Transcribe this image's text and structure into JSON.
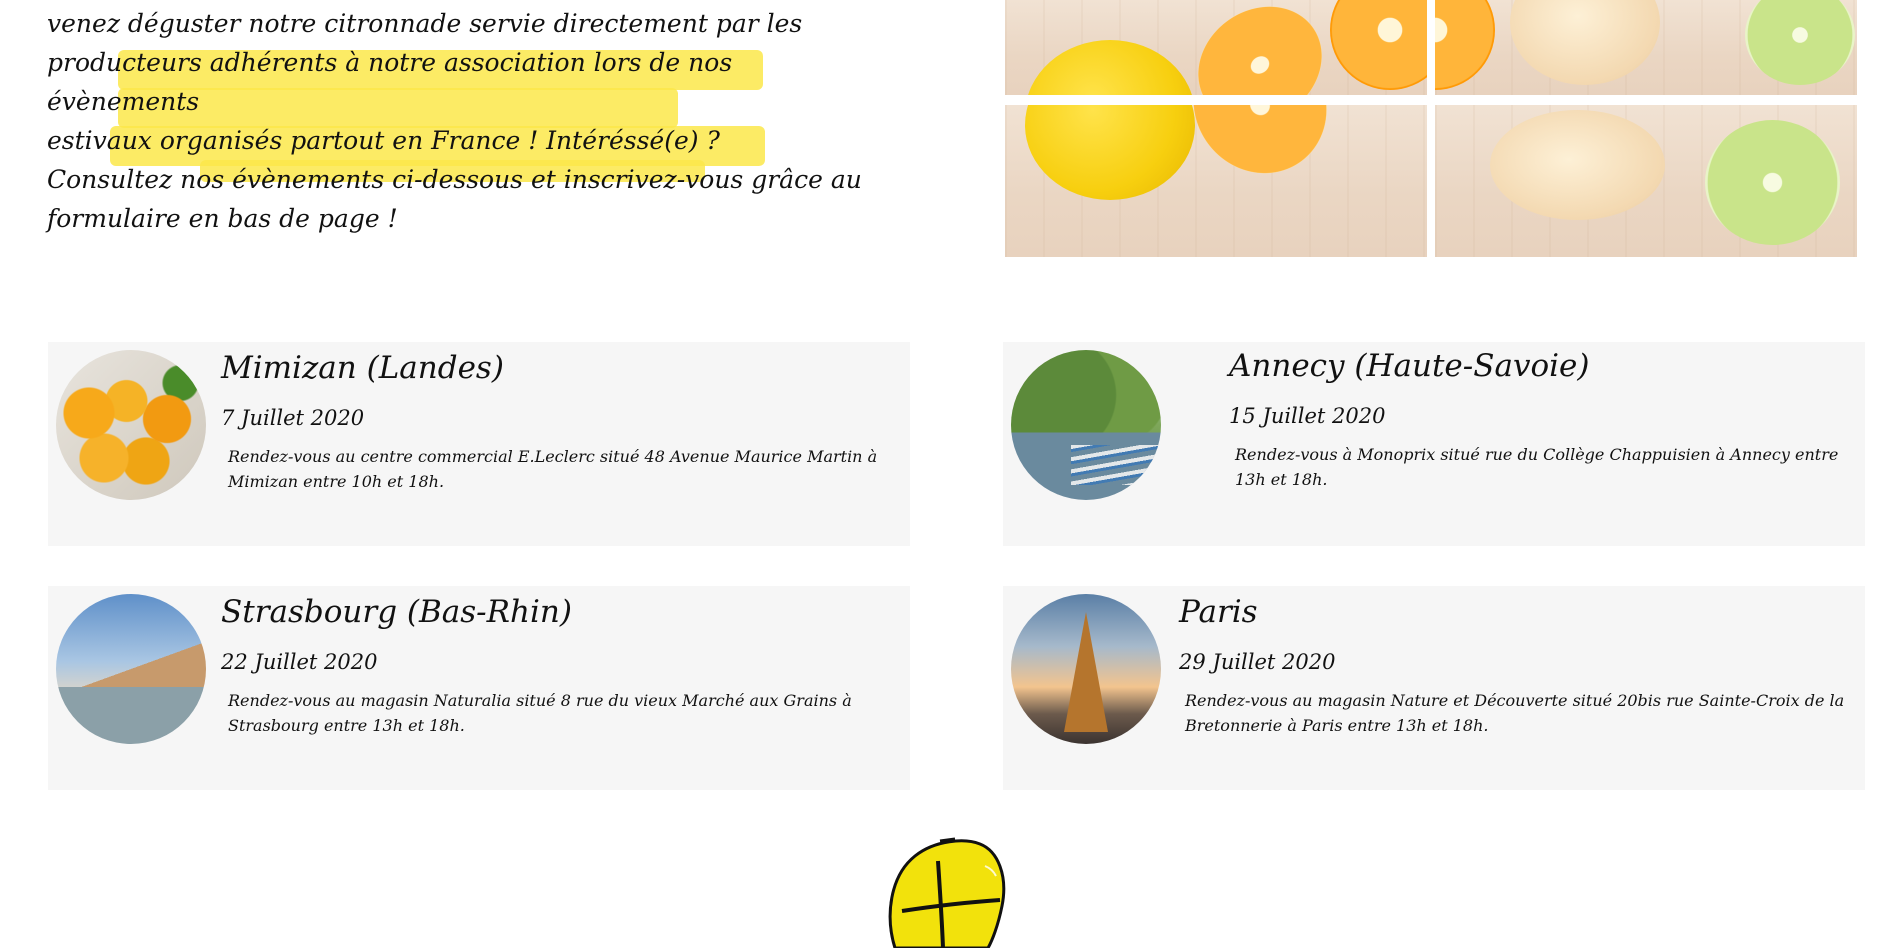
{
  "intro": {
    "lines": [
      "venez déguster notre citronnade servie directement par les",
      "producteurs adhérents à notre association lors de nos évènements",
      "estivaux organisés partout en France ! Intéréssé(e) ?",
      "Consultez nos évènements ci-dessous et inscrivez-vous grâce au",
      "formulaire en bas de page !"
    ]
  },
  "hero_image": {
    "icon": "citrus-fruits-grid-image"
  },
  "events": [
    {
      "title": "Mimizan (Landes)",
      "date": "7 Juillet 2020",
      "description": "Rendez-vous au centre commercial E.Leclerc situé 48 Avenue Maurice Martin à Mimizan entre 10h et 18h.",
      "photo": "oranges-photo"
    },
    {
      "title": "Annecy (Haute-Savoie)",
      "date": "15 Juillet 2020",
      "description": "Rendez-vous à Monoprix situé rue du Collège Chappuisien à Annecy entre 13h et 18h.",
      "photo": "annecy-lake-photo"
    },
    {
      "title": "Strasbourg (Bas-Rhin)",
      "date": "22 Juillet 2020",
      "description": "Rendez-vous au magasin Naturalia situé 8 rue du vieux Marché aux Grains à Strasbourg entre 13h et 18h.",
      "photo": "strasbourg-photo"
    },
    {
      "title": "Paris",
      "date": "29 Juillet 2020",
      "description": "Rendez-vous au magasin Nature et Découverte situé 20bis rue Sainte-Croix de la Bretonnerie à Paris entre 13h et 18h.",
      "photo": "eiffel-tower-photo"
    }
  ],
  "colors": {
    "highlight": "#fbe74a",
    "card_background": "#f6f6f6",
    "lemon": "#f2e20c"
  },
  "logo": {
    "icon": "lemon-logo-icon"
  }
}
